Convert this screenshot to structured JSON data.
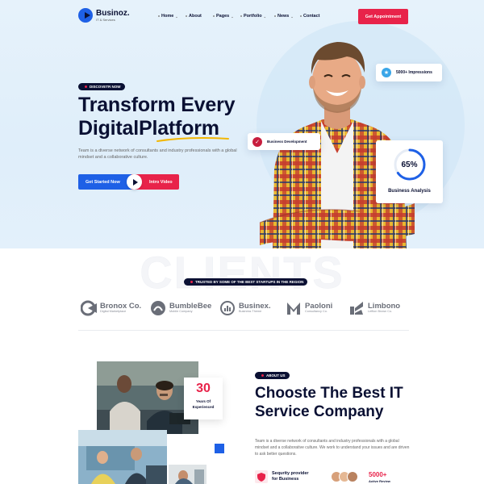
{
  "header": {
    "logo_name": "Businoz.",
    "logo_sub": "IT & Services",
    "nav": [
      {
        "label": "Home",
        "has_dropdown": true
      },
      {
        "label": "About",
        "has_dropdown": false
      },
      {
        "label": "Pages",
        "has_dropdown": true
      },
      {
        "label": "Portfolio",
        "has_dropdown": true
      },
      {
        "label": "News",
        "has_dropdown": true
      },
      {
        "label": "Contact",
        "has_dropdown": false
      }
    ],
    "cta": "Get Appointment"
  },
  "hero": {
    "tag": "DISCOVETR NOW",
    "title_line1": "Transform Every",
    "title_line2": "DigitalPlatform",
    "description": "Team is a diverse network of consultants and industry professionals with a global mindset and a collaborative culture.",
    "btn_start": "Get Started Now",
    "btn_video": "Intro Video",
    "impressions": "5000+ Impressions",
    "business_development": "Business Development",
    "analysis_percent": "65%",
    "analysis_value": 0.65,
    "analysis_label": "Business Analysis"
  },
  "clients": {
    "watermark": "CLIENTS",
    "tag": "TRUSTED BY SOME OF THE BEST STARTUPS IN THE REGION",
    "brands": [
      {
        "name": "Bronox Co.",
        "sub": "Digital Marketplace"
      },
      {
        "name": "BumbleBee",
        "sub": "Mobile Company"
      },
      {
        "name": "Businex.",
        "sub": "Business Theme"
      },
      {
        "name": "Paoloni",
        "sub": "Consultancy Co."
      },
      {
        "name": "Limbono",
        "sub": "Leftlon Brown Co."
      }
    ]
  },
  "about": {
    "stat_number": "30",
    "stat_label_line1": "Years Of",
    "stat_label_line2": "Experienced",
    "tag": "ABOUT US",
    "title_line1": "Chooste The Best IT",
    "title_line2": "Service Company",
    "description": "Team is a diverse network of consultants and industry professionals with a global mindset and a collaborative culture. We work to understand your issues and are driven to ask better questions.",
    "security_line1": "Sequrity provider",
    "security_line2": "for Business",
    "review_count": "5000+",
    "review_label": "Active Review"
  },
  "colors": {
    "primary_blue": "#1e60e6",
    "accent_red": "#e8234a",
    "navy": "#0a1033",
    "hero_bg": "#e6f2fb",
    "analysis_ring": "#1e60e6"
  }
}
